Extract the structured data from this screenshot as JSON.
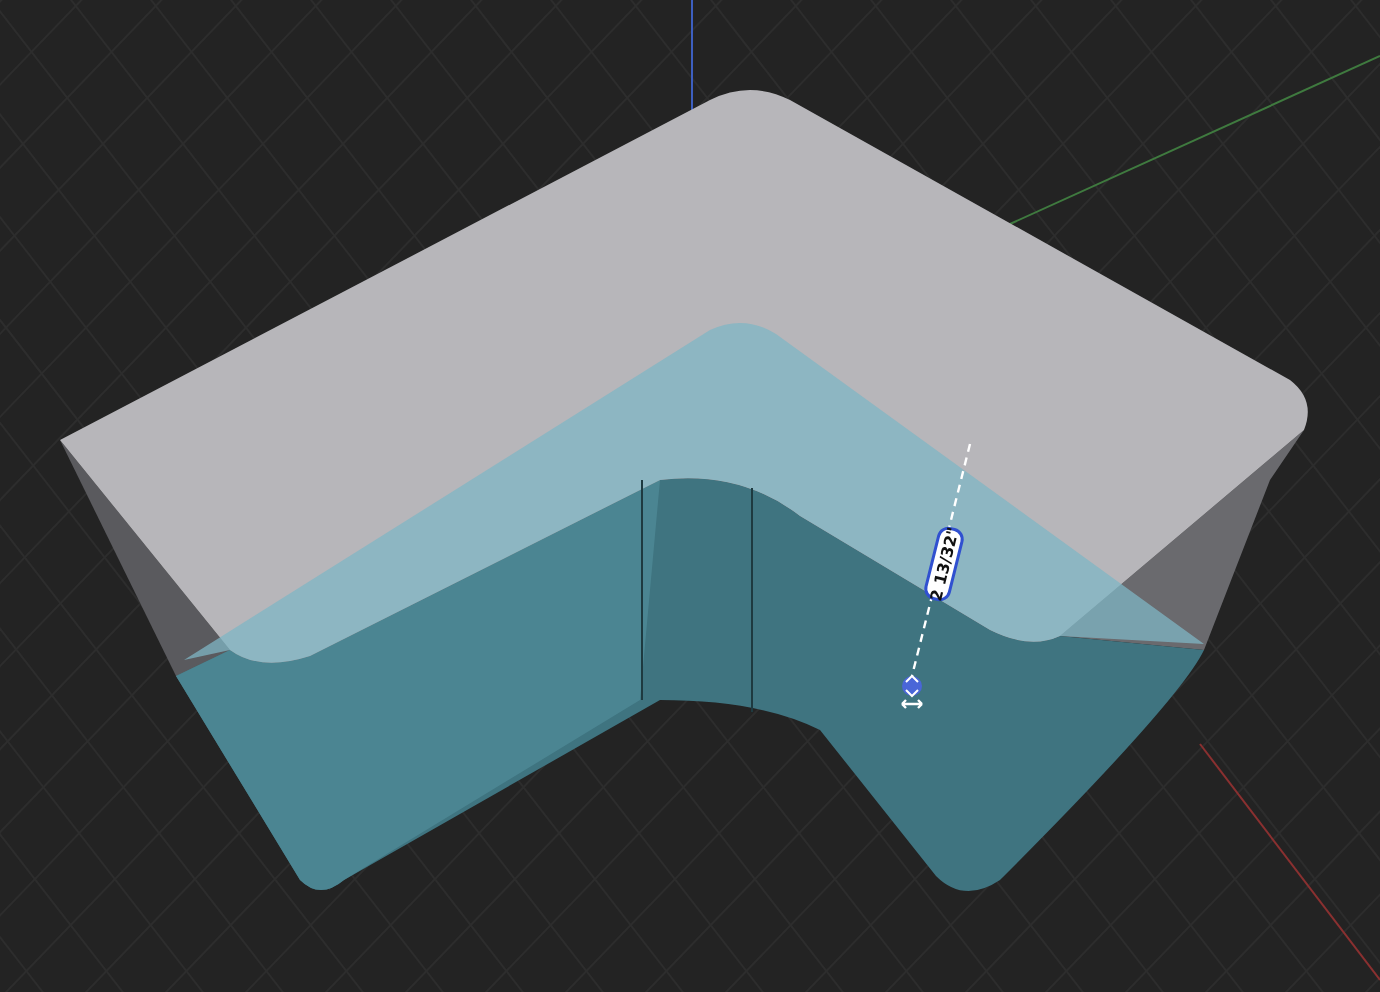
{
  "viewport": {
    "dimension": {
      "label": "2 13/32\""
    }
  }
}
